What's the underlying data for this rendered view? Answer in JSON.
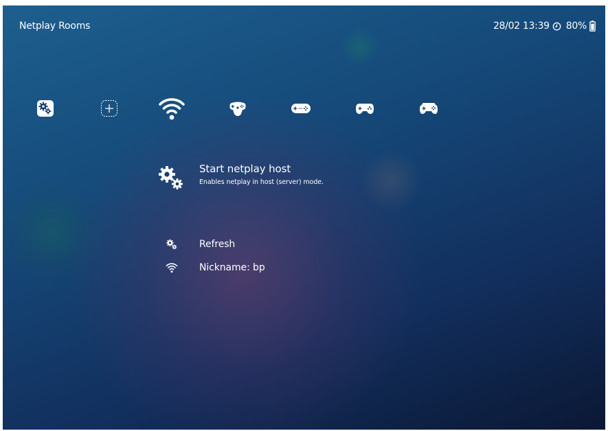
{
  "header": {
    "title": "Netplay Rooms",
    "datetime": "28/02 13:39",
    "battery_percent": "80%",
    "clock_icon": "clock-icon",
    "battery_icon": "battery-icon"
  },
  "tabs": [
    {
      "name": "settings",
      "icon": "gear-icon"
    },
    {
      "name": "add",
      "icon": "plus-icon"
    },
    {
      "name": "netplay",
      "icon": "wifi-icon",
      "selected": true
    },
    {
      "name": "n64-controller",
      "icon": "n64-controller-icon"
    },
    {
      "name": "snes-controller",
      "icon": "snes-controller-icon"
    },
    {
      "name": "gamepad",
      "icon": "gamepad-icon"
    },
    {
      "name": "gamepad-2",
      "icon": "gamepad-icon"
    }
  ],
  "menu": {
    "selected": {
      "label": "Start netplay host",
      "sublabel": "Enables netplay in host (server) mode.",
      "icon": "gear-icon"
    },
    "items": [
      {
        "label": "Refresh",
        "icon": "gear-icon"
      },
      {
        "label": "Nickname: bp",
        "icon": "wifi-icon"
      }
    ]
  },
  "colors": {
    "text": "#ffffff",
    "background_top": "#1d5f8e",
    "background_bottom": "#0b1834"
  }
}
